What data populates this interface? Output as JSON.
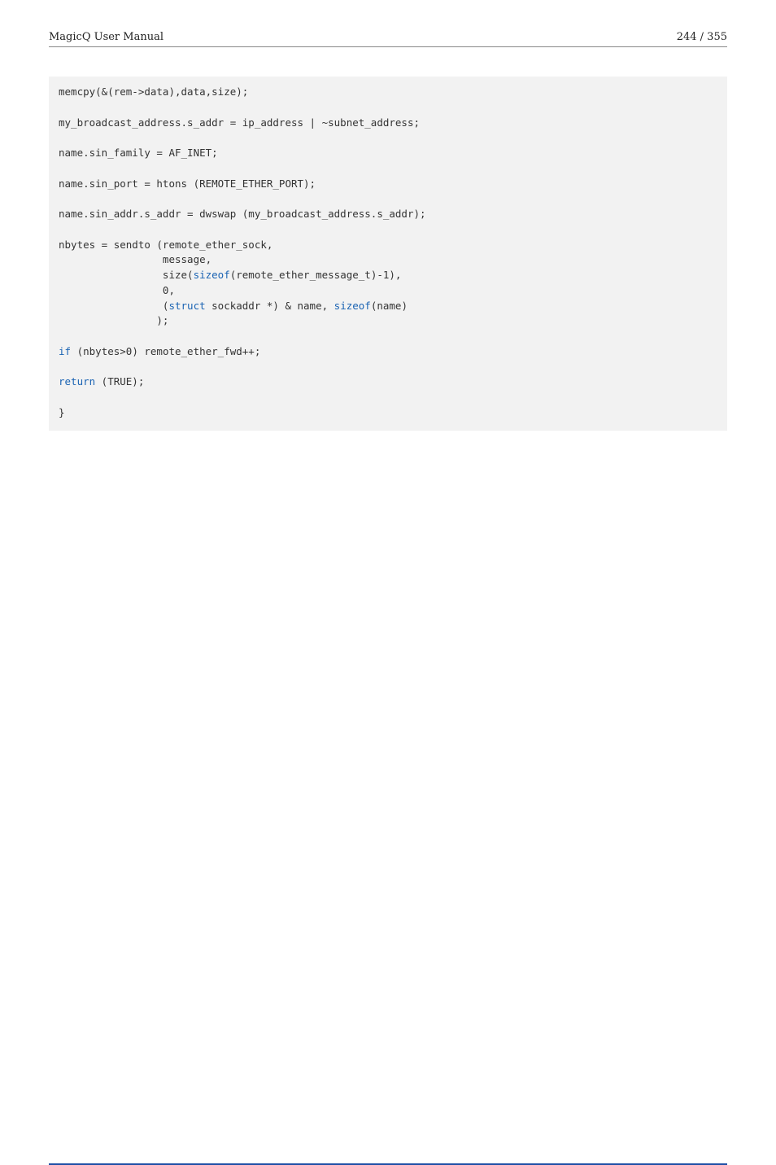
{
  "header": {
    "left": "MagicQ User Manual",
    "right": "244 / 355"
  },
  "code": {
    "l01": "memcpy(&(rem->data),data,size);",
    "l02": "my_broadcast_address.s_addr = ip_address | ~subnet_address;",
    "l03": "name.sin_family = AF_INET;",
    "l04": "name.sin_port = htons (REMOTE_ETHER_PORT);",
    "l05": "name.sin_addr.s_addr = dwswap (my_broadcast_address.s_addr);",
    "l06": "nbytes = sendto (remote_ether_sock,",
    "l07": "                 message,",
    "l08a": "                 size(",
    "kw_sizeof1": "sizeof",
    "l08b": "(remote_ether_message_t)-1),",
    "l09": "                 0,",
    "l10a": "                 (",
    "kw_struct": "struct",
    "l10b": " sockaddr *) & name, ",
    "kw_sizeof2": "sizeof",
    "l10c": "(name)",
    "l11": "                );",
    "kw_if": "if",
    "l12": " (nbytes>0) remote_ether_fwd++;",
    "kw_return": "return",
    "l13": " (TRUE);",
    "l14": "}"
  }
}
